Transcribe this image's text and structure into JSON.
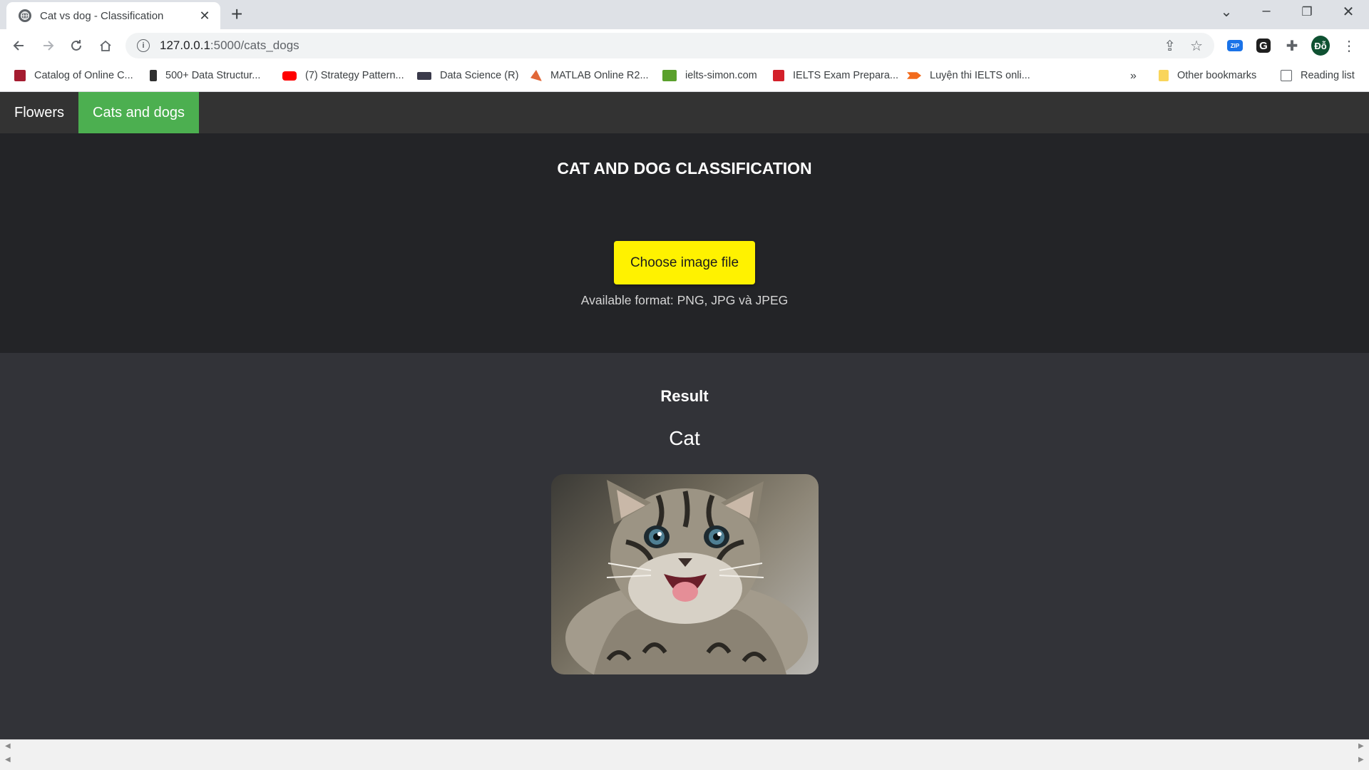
{
  "browser": {
    "tab_title": "Cat vs dog - Classification",
    "url_host": "127.0.0.1",
    "url_rest": ":5000/cats_dogs",
    "avatar_initials": "Đỗ",
    "zip_badge": "ZIP",
    "g_badge": "G"
  },
  "bookmarks": {
    "items": [
      {
        "label": "Catalog of Online C...",
        "color": "#a51c30"
      },
      {
        "label": "500+ Data Structur...",
        "color": "#2f2f2f"
      },
      {
        "label": "(7) Strategy Pattern...",
        "color": "#ff0000"
      },
      {
        "label": "Data Science (R)",
        "color": "#3a3a4a"
      },
      {
        "label": "MATLAB Online R2...",
        "color": "#e16737"
      },
      {
        "label": "ielts-simon.com",
        "color": "#5aa02c"
      },
      {
        "label": "IELTS Exam Prepara...",
        "color": "#d3202a"
      },
      {
        "label": "Luyện thi IELTS onli...",
        "color": "#f26b1d"
      }
    ],
    "overflow": "»",
    "other": "Other bookmarks",
    "reading_list": "Reading list"
  },
  "nav": {
    "items": [
      {
        "label": "Flowers",
        "active": false
      },
      {
        "label": "Cats and dogs",
        "active": true
      }
    ],
    "active_color": "#4caf50"
  },
  "hero": {
    "title": "CAT AND DOG CLASSIFICATION",
    "upload_button": "Choose image file",
    "formats": "Available format: PNG, JPG và JPEG",
    "button_color": "#fff200"
  },
  "result": {
    "heading": "Result",
    "label": "Cat",
    "image": "kitten-photo"
  }
}
